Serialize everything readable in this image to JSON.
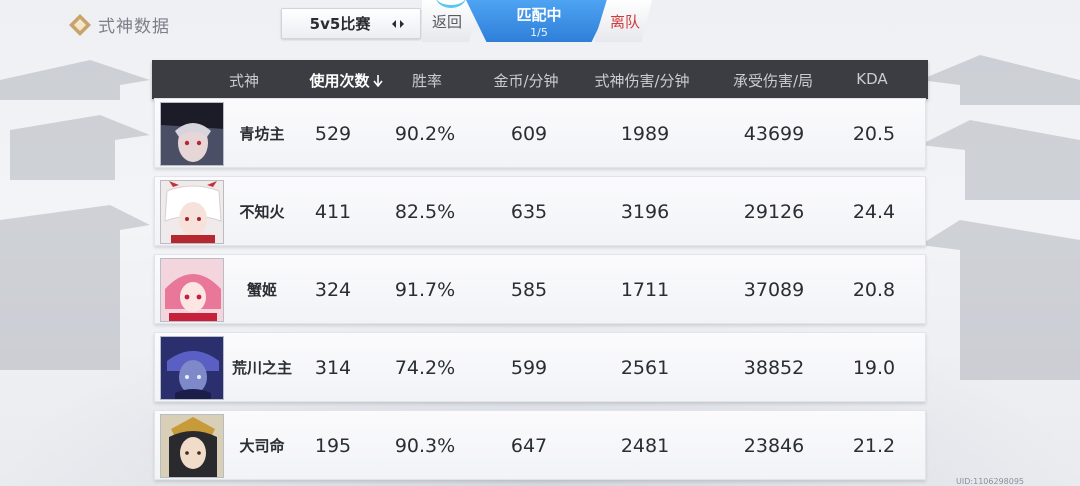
{
  "header": {
    "title": "式神数据",
    "mode_selector": {
      "label": "5v5比赛"
    },
    "back_label": "返回",
    "matching": {
      "status": "匹配中",
      "count": "1/5"
    },
    "leave_label": "离队"
  },
  "table": {
    "columns": [
      "式神",
      "使用次数",
      "胜率",
      "金币/分钟",
      "式神伤害/分钟",
      "承受伤害/局",
      "KDA"
    ],
    "sorted_column": "使用次数",
    "rows": [
      {
        "name": "青坊主",
        "uses": "529",
        "win_rate": "90.2%",
        "gold_per_min": "609",
        "damage_per_min": "1989",
        "damage_taken": "43699",
        "kda": "20.5"
      },
      {
        "name": "不知火",
        "uses": "411",
        "win_rate": "82.5%",
        "gold_per_min": "635",
        "damage_per_min": "3196",
        "damage_taken": "29126",
        "kda": "24.4"
      },
      {
        "name": "蟹姬",
        "uses": "324",
        "win_rate": "91.7%",
        "gold_per_min": "585",
        "damage_per_min": "1711",
        "damage_taken": "37089",
        "kda": "20.8"
      },
      {
        "name": "荒川之主",
        "uses": "314",
        "win_rate": "74.2%",
        "gold_per_min": "599",
        "damage_per_min": "2561",
        "damage_taken": "38852",
        "kda": "19.0"
      },
      {
        "name": "大司命",
        "uses": "195",
        "win_rate": "90.3%",
        "gold_per_min": "647",
        "damage_per_min": "2481",
        "damage_taken": "23846",
        "kda": "21.2"
      }
    ]
  },
  "footer": {
    "uid": "UID:1106298095"
  },
  "colors": {
    "accent_blue": "#2f7fd9",
    "leave_red": "#d23a3a",
    "header_bg": "#3c3d42"
  }
}
